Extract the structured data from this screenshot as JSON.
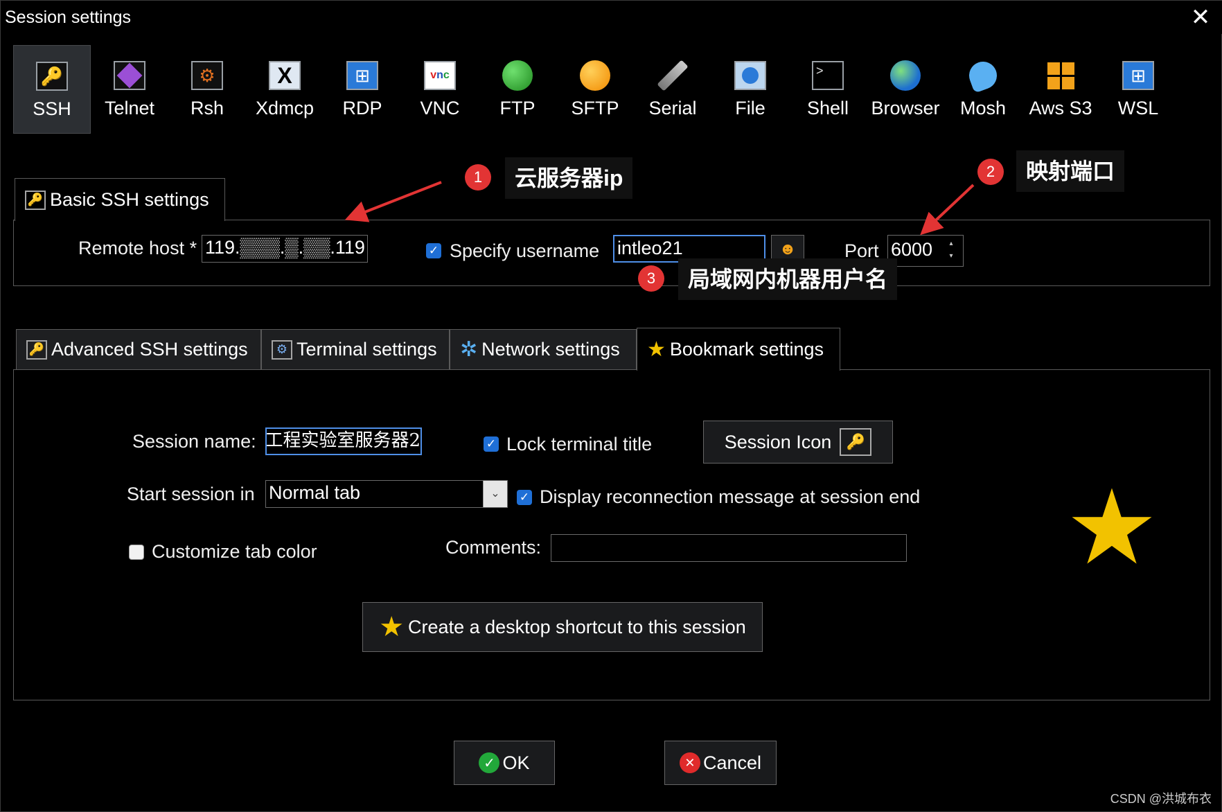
{
  "window": {
    "title": "Session settings"
  },
  "session_types": [
    {
      "label": "SSH",
      "icon": "key-icon",
      "selected": true
    },
    {
      "label": "Telnet",
      "icon": "gem-icon"
    },
    {
      "label": "Rsh",
      "icon": "gears-icon"
    },
    {
      "label": "Xdmcp",
      "icon": "x-display-icon"
    },
    {
      "label": "RDP",
      "icon": "windows-icon"
    },
    {
      "label": "VNC",
      "icon": "vnc-icon"
    },
    {
      "label": "FTP",
      "icon": "globe-green-icon"
    },
    {
      "label": "SFTP",
      "icon": "globe-orange-icon"
    },
    {
      "label": "Serial",
      "icon": "plug-icon"
    },
    {
      "label": "File",
      "icon": "monitor-globe-icon"
    },
    {
      "label": "Shell",
      "icon": "terminal-icon"
    },
    {
      "label": "Browser",
      "icon": "globe-blue-icon"
    },
    {
      "label": "Mosh",
      "icon": "satellite-icon"
    },
    {
      "label": "Aws S3",
      "icon": "cubes-icon"
    },
    {
      "label": "WSL",
      "icon": "windows-icon"
    }
  ],
  "basic": {
    "tab_label": "Basic SSH settings",
    "remote_host_label": "Remote host *",
    "remote_host_value": "119.▒▒▒.▒.▒▒.119",
    "specify_username_label": "Specify username",
    "specify_username_checked": true,
    "username_value": "intleo21",
    "port_label": "Port",
    "port_value": "6000"
  },
  "annotations": [
    {
      "number": "1",
      "text": "云服务器ip"
    },
    {
      "number": "2",
      "text": "映射端口"
    },
    {
      "number": "3",
      "text": "局域网内机器用户名"
    }
  ],
  "tabs": [
    {
      "label": "Advanced SSH settings",
      "active": false
    },
    {
      "label": "Terminal settings",
      "active": false
    },
    {
      "label": "Network settings",
      "active": false
    },
    {
      "label": "Bookmark settings",
      "active": true
    }
  ],
  "bookmark": {
    "session_name_label": "Session name:",
    "session_name_value": "工程实验室服务器2",
    "lock_title_label": "Lock terminal title",
    "lock_title_checked": true,
    "session_icon_label": "Session Icon",
    "start_in_label": "Start session in",
    "start_in_value": "Normal tab",
    "reconnect_label": "Display reconnection message at session end",
    "reconnect_checked": true,
    "customize_color_label": "Customize tab color",
    "customize_color_checked": false,
    "comments_label": "Comments:",
    "comments_value": "",
    "shortcut_label": "Create a desktop shortcut to this session"
  },
  "footer": {
    "ok_label": "OK",
    "cancel_label": "Cancel"
  },
  "watermark": "CSDN @洪城布衣",
  "colors": {
    "accent": "#1f6fd6",
    "annotation_red": "#e23434",
    "star": "#f2c200"
  }
}
